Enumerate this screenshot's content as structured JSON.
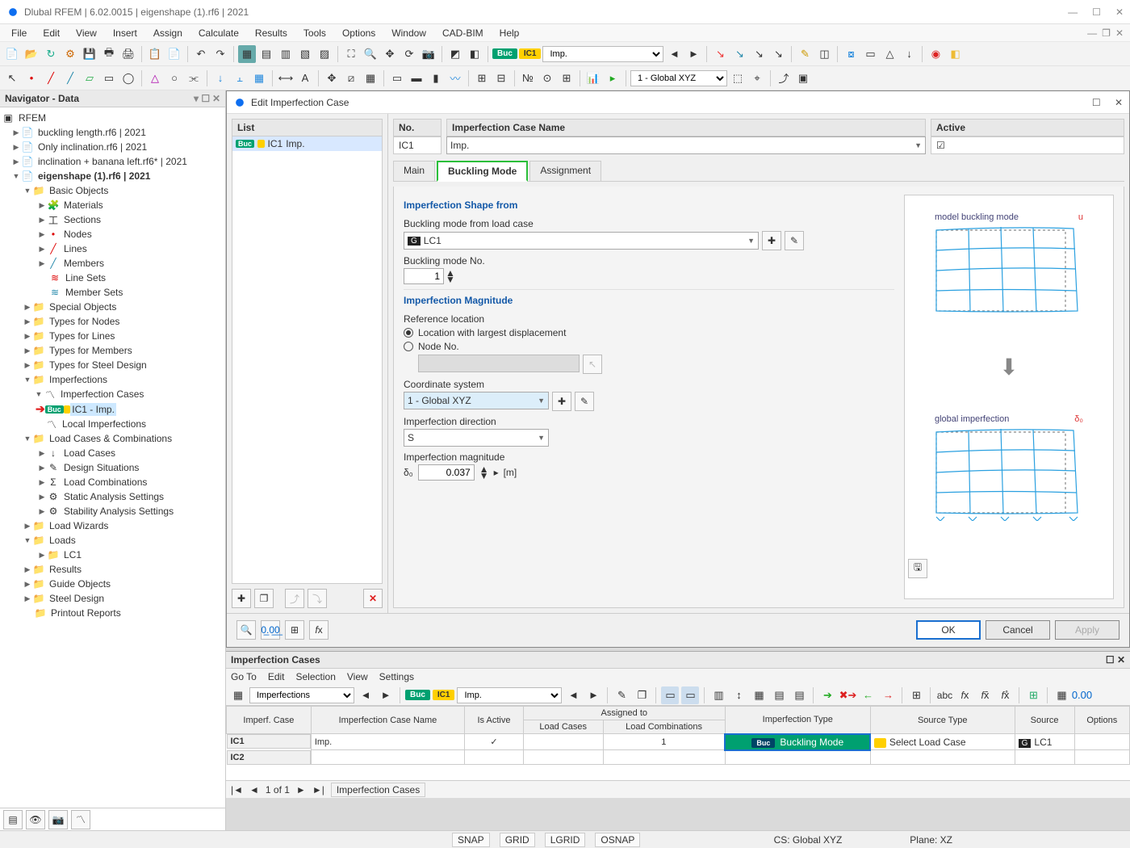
{
  "app": {
    "title": "Dlubal RFEM | 6.02.0015 | eigenshape (1).rf6 | 2021"
  },
  "menu": [
    "File",
    "Edit",
    "View",
    "Insert",
    "Assign",
    "Calculate",
    "Results",
    "Tools",
    "Options",
    "Window",
    "CAD-BIM",
    "Help"
  ],
  "toolbar1": {
    "buc": "Buc",
    "ic1": "IC1",
    "combo": "Imp."
  },
  "toolbar2": {
    "globalxyz": "1 - Global XYZ"
  },
  "navigator": {
    "title": "Navigator - Data",
    "root": "RFEM",
    "files": [
      "buckling length.rf6 | 2021",
      "Only inclination.rf6 | 2021",
      "inclination + banana left.rf6* | 2021"
    ],
    "activeFile": "eigenshape (1).rf6 | 2021",
    "basic": {
      "label": "Basic Objects",
      "children": [
        "Materials",
        "Sections",
        "Nodes",
        "Lines",
        "Members",
        "Line Sets",
        "Member Sets"
      ]
    },
    "mid": [
      "Special Objects",
      "Types for Nodes",
      "Types for Lines",
      "Types for Members",
      "Types for Steel Design"
    ],
    "imperfections": {
      "label": "Imperfections",
      "cases": "Imperfection Cases",
      "ic1": "IC1 - Imp.",
      "local": "Local Imperfections"
    },
    "loadcomb": {
      "label": "Load Cases & Combinations",
      "children": [
        "Load Cases",
        "Design Situations",
        "Load Combinations",
        "Static Analysis Settings",
        "Stability Analysis Settings"
      ]
    },
    "loadwiz": "Load Wizards",
    "loads": {
      "label": "Loads",
      "lc1": "LC1"
    },
    "tail": [
      "Results",
      "Guide Objects",
      "Steel Design",
      "Printout Reports"
    ]
  },
  "dialog": {
    "title": "Edit Imperfection Case",
    "listHeader": "List",
    "listRow": {
      "buc": "Buc",
      "ic1": "IC1",
      "imp": "Imp."
    },
    "noHeader": "No.",
    "noValue": "IC1",
    "nameHeader": "Imperfection Case Name",
    "nameValue": "Imp.",
    "activeHeader": "Active",
    "tabs": [
      "Main",
      "Buckling Mode",
      "Assignment"
    ],
    "sec1": "Imperfection Shape from",
    "lbl_lc": "Buckling mode from load case",
    "lc_val": "LC1",
    "lc_badge": "G",
    "lbl_modeNo": "Buckling mode No.",
    "modeNo": "1",
    "sec2": "Imperfection Magnitude",
    "lbl_refloc": "Reference location",
    "radio1": "Location with largest displacement",
    "radio2": "Node No.",
    "lbl_cs": "Coordinate system",
    "cs_val": "1 - Global XYZ",
    "lbl_dir": "Imperfection direction",
    "dir_val": "S",
    "lbl_mag": "Imperfection magnitude",
    "mag_sym": "δ₀",
    "mag_val": "0.037",
    "mag_unit": "[m]",
    "preview1": "model buckling mode",
    "preview1_u": "u",
    "preview2": "global imperfection",
    "preview2_d": "δ₀",
    "btn_ok": "OK",
    "btn_cancel": "Cancel",
    "btn_apply": "Apply"
  },
  "bottom": {
    "title": "Imperfection Cases",
    "menu": [
      "Go To",
      "Edit",
      "Selection",
      "View",
      "Settings"
    ],
    "combo1": "Imperfections",
    "buc": "Buc",
    "ic1": "IC1",
    "combo2": "Imp.",
    "grid": {
      "groupAssigned": "Assigned to",
      "cols": [
        "Imperf. Case",
        "Imperfection Case Name",
        "Is Active",
        "Load Cases",
        "Load Combinations",
        "Imperfection Type",
        "Source Type",
        "Source",
        "Options"
      ],
      "row1": {
        "id": "IC1",
        "name": "Imp.",
        "active": "✓",
        "lc": "",
        "lco": "1",
        "type_badge": "Buc",
        "type": "Buckling Mode",
        "src_type": "Select Load Case",
        "src_badge": "G",
        "src": "LC1"
      },
      "row2": {
        "id": "IC2"
      }
    },
    "status_pages": "1 of 1",
    "status_name": "Imperfection Cases"
  },
  "statusbar": {
    "snap": "SNAP",
    "grid": "GRID",
    "lgrid": "LGRID",
    "osnap": "OSNAP",
    "cs": "CS: Global XYZ",
    "plane": "Plane: XZ"
  }
}
